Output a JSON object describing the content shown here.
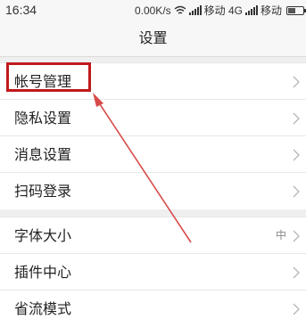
{
  "status_bar": {
    "time": "16:34",
    "net_speed": "0.00K/s",
    "carrier": "移动 4G",
    "battery_level": 0.55
  },
  "header": {
    "title": "设置"
  },
  "settings": {
    "group1": [
      {
        "label": "帐号管理",
        "value": ""
      },
      {
        "label": "隐私设置",
        "value": ""
      },
      {
        "label": "消息设置",
        "value": ""
      },
      {
        "label": "扫码登录",
        "value": ""
      }
    ],
    "group2": [
      {
        "label": "字体大小",
        "value": "中"
      },
      {
        "label": "插件中心",
        "value": ""
      },
      {
        "label": "省流模式",
        "value": ""
      }
    ]
  },
  "colors": {
    "annotation": "#c0191c",
    "background": "#ffffff",
    "section_gap": "#efefef"
  },
  "icons": {
    "chevron": "chevron-right-icon",
    "wifi": "wifi-icon",
    "signal": "signal-icon",
    "battery": "battery-icon"
  }
}
